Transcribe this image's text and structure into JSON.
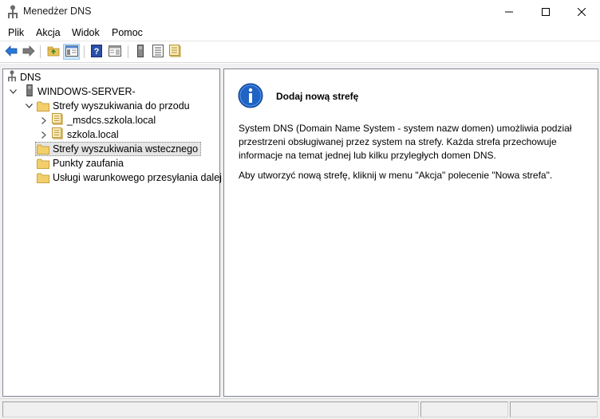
{
  "window": {
    "title": "Menedżer DNS"
  },
  "menu": {
    "items": [
      "Plik",
      "Akcja",
      "Widok",
      "Pomoc"
    ]
  },
  "toolbar": {
    "buttons": [
      "back-arrow-icon",
      "forward-arrow-icon",
      "up-folder-icon",
      "show-hide-tree-icon",
      "help-icon",
      "properties-view-icon",
      "server-icon",
      "list-icon",
      "zone-icon"
    ]
  },
  "tree": {
    "root": "DNS",
    "server": "WINDOWS-SERVER-",
    "forward_zones": "Strefy wyszukiwania do przodu",
    "zones": [
      "_msdcs.szkola.local",
      "szkola.local"
    ],
    "reverse_zones": "Strefy wyszukiwania wstecznego",
    "trust_points": "Punkty zaufania",
    "conditional_forwarders": "Usługi warunkowego przesyłania dalej"
  },
  "content": {
    "heading": "Dodaj nową strefę",
    "para1_line1": "System DNS (Domain Name System - system nazw domen) umożliwia podział",
    "para1_line2": "przestrzeni obsługiwanej przez system na strefy. Każda strefa przechowuje",
    "para1_line3": "informacje na temat jednej lub kilku przyległych domen DNS.",
    "para2": "Aby utworzyć nową strefę, kliknij w menu \"Akcja\" polecenie \"Nowa strefa\"."
  },
  "colors": {
    "accent_blue": "#1f63c4",
    "folder": "#e8c35a",
    "selection": "#e5e5e5"
  }
}
